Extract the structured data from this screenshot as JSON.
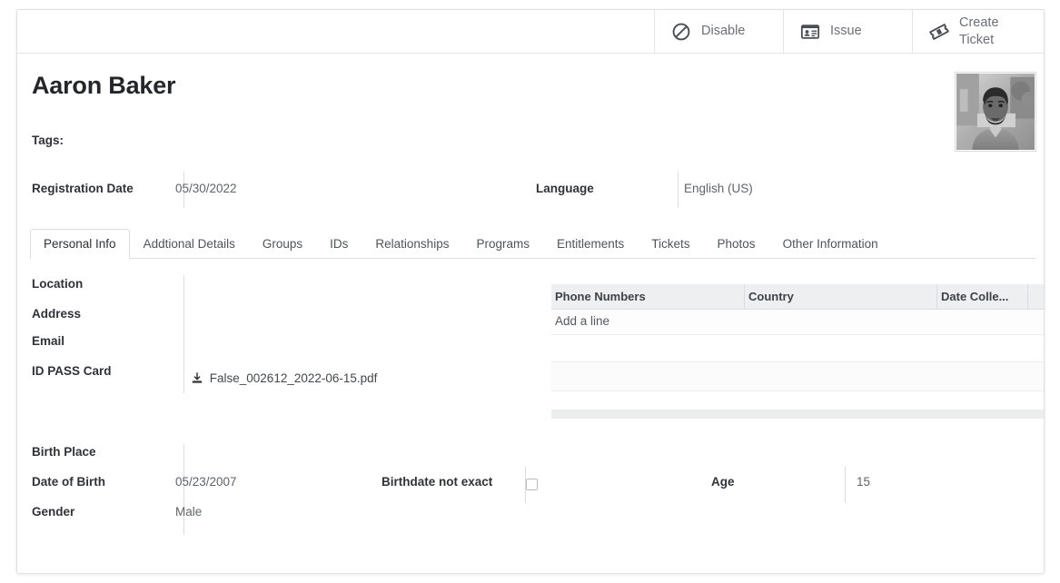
{
  "toolbar": {
    "buttons": [
      {
        "label": "Disable",
        "icon": "ban-circle-icon"
      },
      {
        "label": "Issue",
        "icon": "id-card-icon"
      },
      {
        "label": "Create Ticket",
        "icon": "ticket-icon"
      }
    ]
  },
  "header": {
    "name": "Aaron Baker",
    "tags_label": "Tags:",
    "avatar_alt": "portrait-photo"
  },
  "top_fields": {
    "registration_date_label": "Registration Date",
    "registration_date_value": "05/30/2022",
    "language_label": "Language",
    "language_value": "English (US)"
  },
  "tabs": [
    {
      "label": "Personal Info",
      "active": true
    },
    {
      "label": "Addtional Details",
      "active": false
    },
    {
      "label": "Groups",
      "active": false
    },
    {
      "label": "IDs",
      "active": false
    },
    {
      "label": "Relationships",
      "active": false
    },
    {
      "label": "Programs",
      "active": false
    },
    {
      "label": "Entitlements",
      "active": false
    },
    {
      "label": "Tickets",
      "active": false
    },
    {
      "label": "Photos",
      "active": false
    },
    {
      "label": "Other Information",
      "active": false
    }
  ],
  "personal_info": {
    "location_label": "Location",
    "location_value": "",
    "address_label": "Address",
    "address_value": "",
    "email_label": "Email",
    "email_value": "",
    "id_pass_card_label": "ID PASS Card",
    "id_pass_card_file": "False_002612_2022-06-15.pdf",
    "birth_place_label": "Birth Place",
    "birth_place_value": "",
    "date_of_birth_label": "Date of Birth",
    "date_of_birth_value": "05/23/2007",
    "gender_label": "Gender",
    "gender_value": "Male",
    "birthdate_not_exact_label": "Birthdate not exact",
    "birthdate_not_exact_checked": false,
    "age_label": "Age",
    "age_value": "15"
  },
  "phone_table": {
    "columns": [
      "Phone Numbers",
      "Country",
      "Date Colle...",
      ""
    ],
    "add_line_label": "Add a line",
    "rows": []
  },
  "colors": {
    "page_bg": "#ffffff",
    "card_border": "#dfe0e3",
    "label_text": "#2f3237",
    "value_text": "#5f6469",
    "toolbar_text": "#6b6f76",
    "table_header_bg": "#eeeff0",
    "divider": "#dcdde0"
  }
}
